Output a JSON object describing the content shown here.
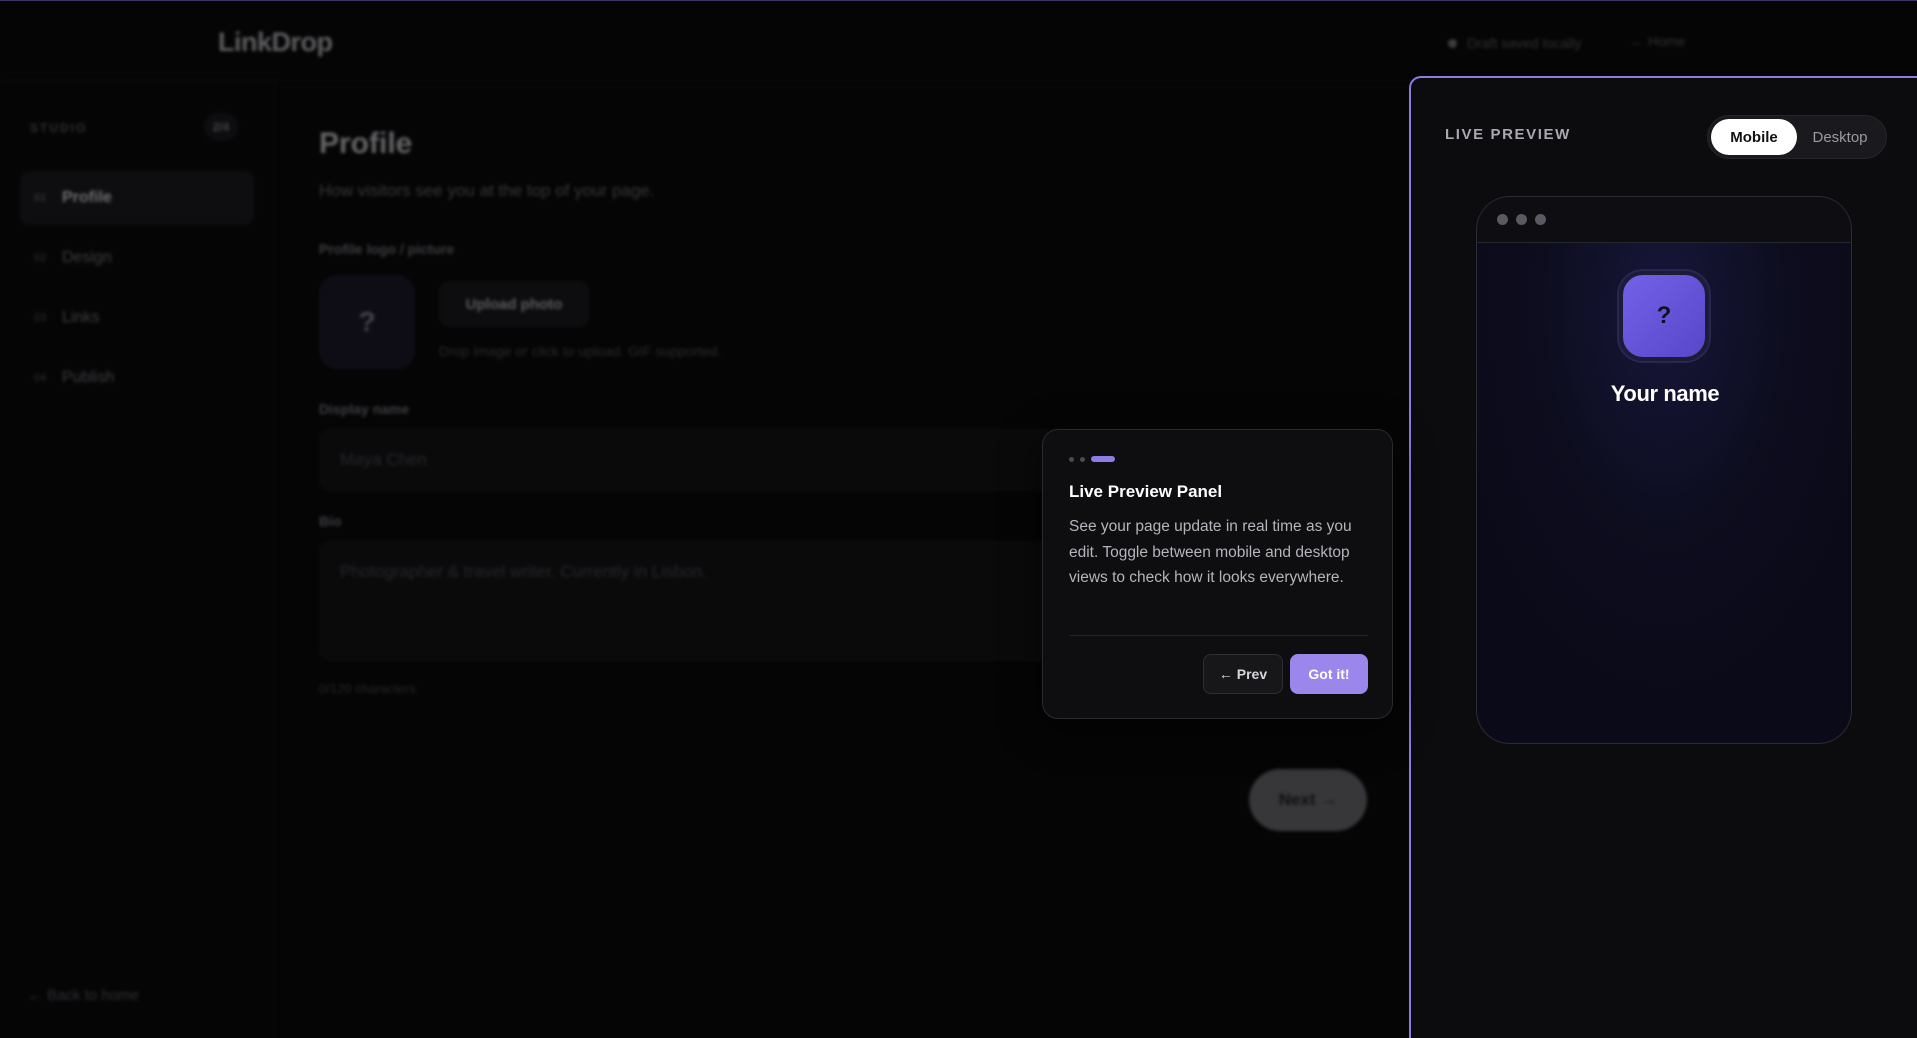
{
  "app": {
    "logo": "LinkDrop",
    "draft_status": "Draft saved locally",
    "home_link": "← Home"
  },
  "sidebar": {
    "section_label": "STUDIO",
    "step_count": "2/4",
    "items": [
      {
        "num": "01",
        "label": "Profile",
        "active": true
      },
      {
        "num": "02",
        "label": "Design",
        "active": false
      },
      {
        "num": "03",
        "label": "Links",
        "active": false
      },
      {
        "num": "04",
        "label": "Publish",
        "active": false
      }
    ],
    "back_link": "← Back to home"
  },
  "main": {
    "title": "Profile",
    "subtitle": "How visitors see you at the top of your page.",
    "photo_label": "Profile logo / picture",
    "avatar_placeholder": "?",
    "upload_button": "Upload photo",
    "upload_hint": "Drop image or click to upload. GIF supported.",
    "display_name_label": "Display name",
    "display_name_placeholder": "Maya Chen",
    "bio_label": "Bio",
    "bio_placeholder": "Photographer & travel writer. Currently in Lisbon.",
    "char_count": "0/120 characters",
    "next_button": "Next →"
  },
  "preview": {
    "label": "LIVE PREVIEW",
    "toggle": {
      "options": [
        "Mobile",
        "Desktop"
      ],
      "selected": "Mobile"
    },
    "avatar_placeholder": "?",
    "name": "Your name"
  },
  "tour": {
    "step": 3,
    "total_steps": 3,
    "title": "Live Preview Panel",
    "body": "See your page update in real time as you edit. Toggle between mobile and desktop views to check how it looks everywhere.",
    "prev_button": "← Prev",
    "done_button": "Got it!"
  },
  "colors": {
    "accent": "#9b86ec",
    "highlight_border": "#8f7ce0",
    "background": "#050506"
  }
}
